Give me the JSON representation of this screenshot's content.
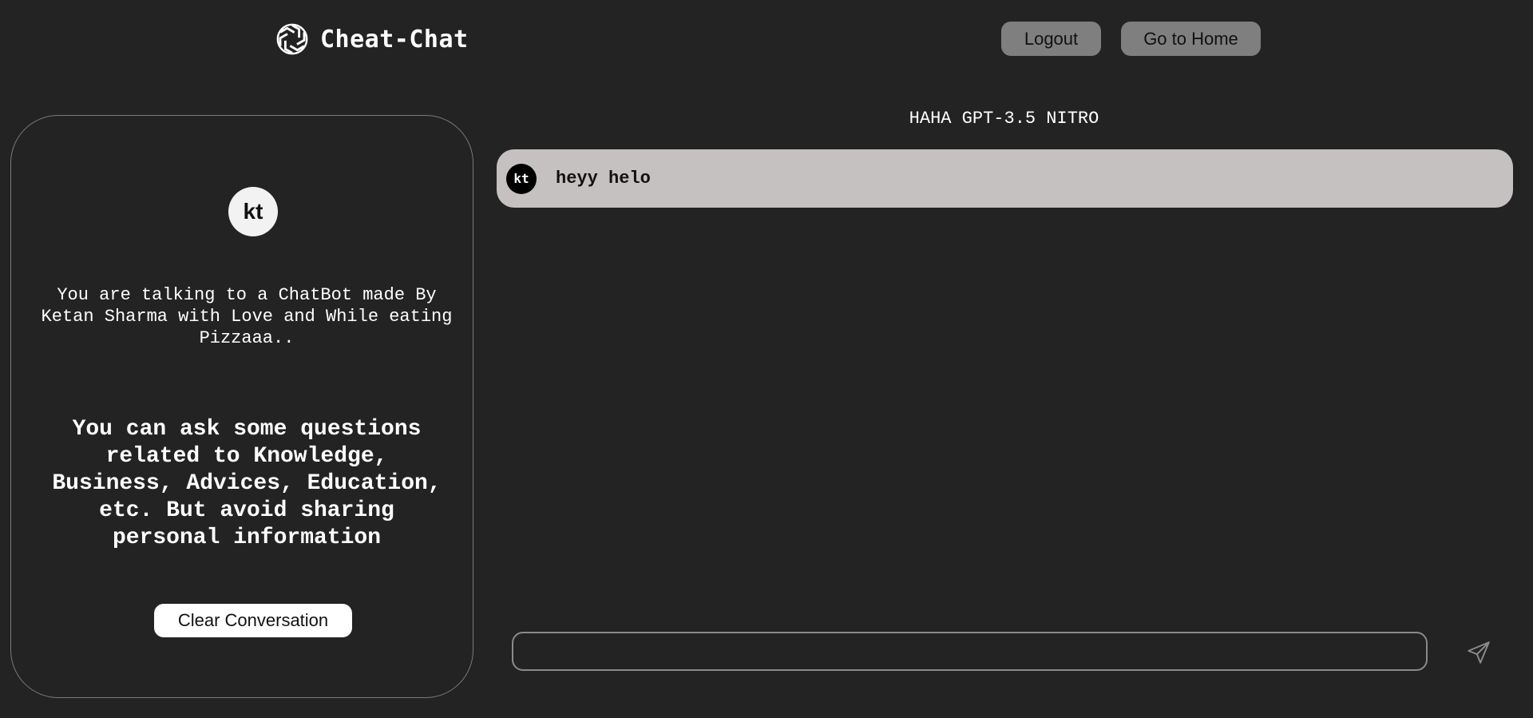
{
  "header": {
    "brand_title": "Cheat-Chat",
    "brand_icon": "openai-logo-icon",
    "logout_label": "Logout",
    "home_label": "Go to Home"
  },
  "sidebar": {
    "avatar_initials": "kt",
    "about": "You are talking to a ChatBot made By Ketan Sharma with Love and While eating Pizzaaa..",
    "tip": "You can ask some questions related to Knowledge, Business, Advices, Education, etc. But avoid sharing personal information",
    "clear_label": "Clear Conversation"
  },
  "chat": {
    "title": "HAHA GPT-3.5 NITRO",
    "messages": [
      {
        "avatar": "kt",
        "text": "heyy helo"
      }
    ],
    "input": {
      "value": "",
      "placeholder": ""
    },
    "send_icon": "send-icon"
  },
  "colors": {
    "background": "#232323",
    "header_button": "#7f7f7f",
    "message_bubble": "#c6c1c1",
    "sidebar_border": "#7a7a7a"
  }
}
